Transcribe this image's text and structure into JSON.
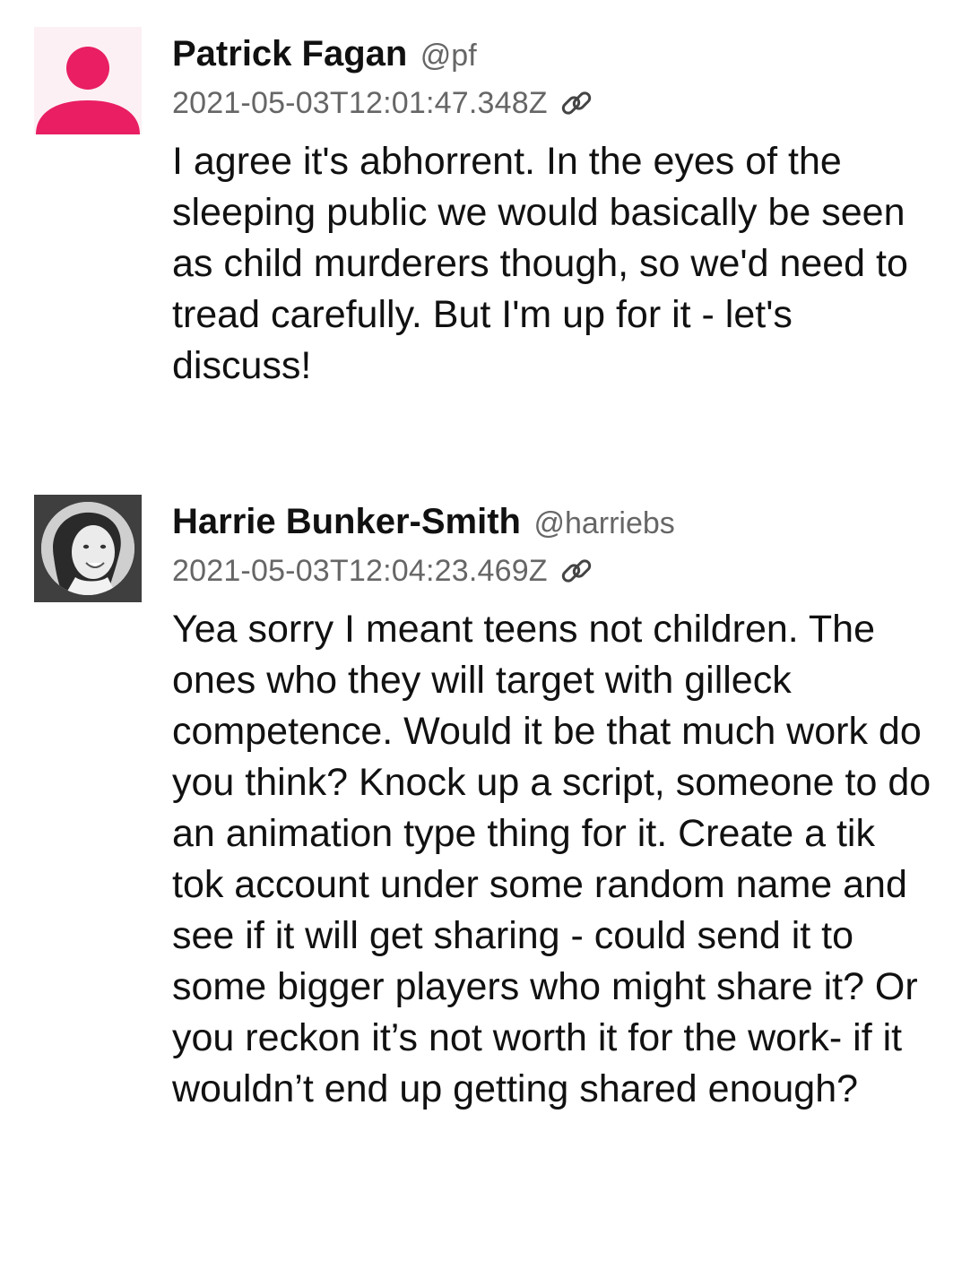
{
  "posts": [
    {
      "author_name": "Patrick Fagan",
      "author_handle": "@pf",
      "timestamp": "2021-05-03T12:01:47.348Z",
      "message": "I agree it's abhorrent. In the eyes of the sleeping public we would basically be seen as child murderers though, so we'd need to tread carefully. But I'm up for it - let's discuss!",
      "avatar_type": "default-person-icon",
      "avatar_color": "#e91e63"
    },
    {
      "author_name": "Harrie Bunker-Smith",
      "author_handle": "@harriebs",
      "timestamp": "2021-05-03T12:04:23.469Z",
      "message": "Yea sorry I meant teens not children. The ones who they will target with gilleck competence. Would it be that much work do you think? Knock up a script, someone to do an animation type thing for it. Create a tik tok account under some random name and see if it will get sharing - could send it to some bigger players who might share it? Or you reckon it’s not worth it for the work- if it wouldn’t end up getting shared enough?",
      "avatar_type": "profile-photo"
    }
  ],
  "icons": {
    "permalink": "link-icon"
  }
}
